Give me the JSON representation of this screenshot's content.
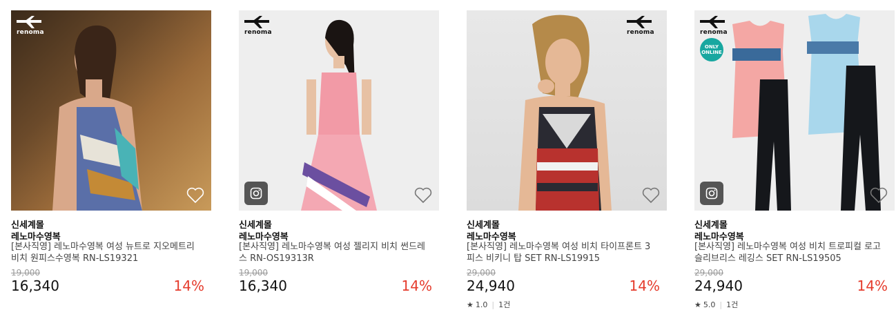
{
  "logo_text": "renoma",
  "accent": "#e53b2c",
  "products": [
    {
      "mall": "신세계몰",
      "brand": "레노마수영복",
      "title": "[본사직영] 레노마수영복 여성 뉴트로 지오메트리 비치 원피스수영복 RN-LS19321",
      "original_price": "19,000",
      "price": "16,340",
      "discount": "14%",
      "has_instagram": false
    },
    {
      "mall": "신세계몰",
      "brand": "레노마수영복",
      "title": "[본사직영] 레노마수영복 여성 젤리지 비치 썬드레스 RN-OS19313R",
      "original_price": "19,000",
      "price": "16,340",
      "discount": "14%",
      "has_instagram": true
    },
    {
      "mall": "신세계몰",
      "brand": "레노마수영복",
      "title": "[본사직영] 레노마수영복 여성 비치 타이프론트 3피스 비키니 탑 SET RN-LS19915",
      "original_price": "29,000",
      "price": "24,940",
      "discount": "14%",
      "rating": "1.0",
      "review_count": "1건"
    },
    {
      "mall": "신세계몰",
      "brand": "레노마수영복",
      "title": "[본사직영] 레노마수영복 여성 비치 트로피컬 로고 슬리브리스 레깅스 SET RN-LS19505",
      "original_price": "29,000",
      "price": "24,940",
      "discount": "14%",
      "rating": "5.0",
      "review_count": "1건",
      "badge": "ONLY ONLINE"
    }
  ]
}
